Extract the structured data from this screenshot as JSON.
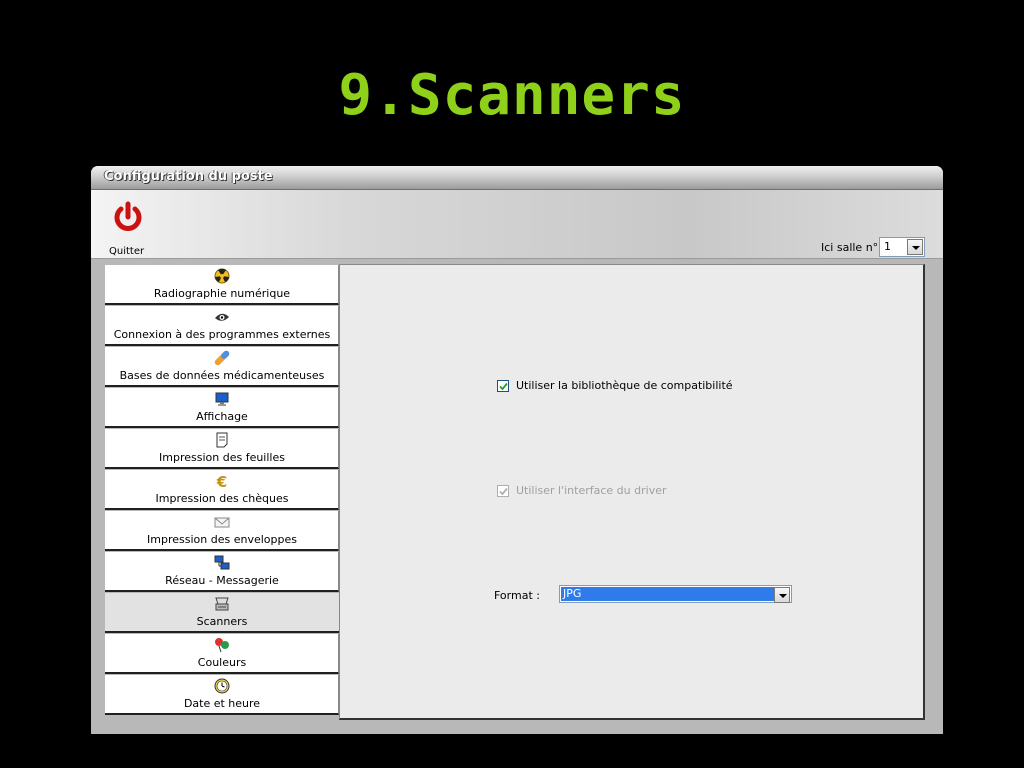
{
  "slide": {
    "title": "9.Scanners"
  },
  "window": {
    "title": "Configuration du poste",
    "toolbar": {
      "quit_label": "Quitter",
      "room_label": "Ici salle n°",
      "room_value": "1"
    }
  },
  "nav": {
    "items": [
      {
        "label": "Radiographie numérique",
        "icon": "radiation-icon"
      },
      {
        "label": "Connexion à des programmes externes",
        "icon": "eye-icon"
      },
      {
        "label": "Bases de données médicamenteuses",
        "icon": "pill-icon"
      },
      {
        "label": "Affichage",
        "icon": "monitor-icon"
      },
      {
        "label": "Impression des feuilles",
        "icon": "document-icon"
      },
      {
        "label": "Impression des chèques",
        "icon": "euro-icon"
      },
      {
        "label": "Impression des enveloppes",
        "icon": "envelope-icon"
      },
      {
        "label": "Réseau - Messagerie",
        "icon": "network-icon"
      },
      {
        "label": "Scanners",
        "icon": "scanner-icon",
        "active": true
      },
      {
        "label": "Couleurs",
        "icon": "colors-icon"
      },
      {
        "label": "Date et heure",
        "icon": "clock-icon"
      }
    ]
  },
  "scanners": {
    "compat_label": "Utiliser la bibliothèque de compatibilité",
    "compat_checked": true,
    "driver_label": "Utiliser l'interface du driver",
    "driver_checked": true,
    "driver_disabled": true,
    "format_label": "Format :",
    "format_value": "JPG"
  },
  "colors": {
    "title_green": "#8fd11a",
    "power_red": "#cc1111",
    "selection_blue": "#2f7bea"
  }
}
